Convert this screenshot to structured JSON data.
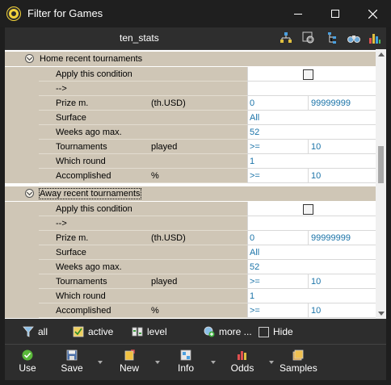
{
  "window": {
    "title": "Filter for Games"
  },
  "header": {
    "title": "ten_stats",
    "icons": [
      "hierarchy-icon",
      "settings-icon",
      "tree-icon",
      "binoculars-icon",
      "bar-chart-icon"
    ]
  },
  "sections": [
    {
      "label": "Home recent tournaments",
      "rows": [
        {
          "name": "Apply this condition",
          "unit": "",
          "value1": "",
          "value2": "",
          "checkbox": true
        },
        {
          "name": "-->",
          "unit": "",
          "value1": "",
          "value2": ""
        },
        {
          "name": "Prize m.",
          "unit": "(th.USD)",
          "value1": "0",
          "value2": "99999999"
        },
        {
          "name": "Surface",
          "unit": "",
          "value1": "All",
          "value2": ""
        },
        {
          "name": "Weeks ago max.",
          "unit": "",
          "value1": "52",
          "value2": ""
        },
        {
          "name": "Tournaments",
          "unit": "played",
          "value1": ">=",
          "value2": "10"
        },
        {
          "name": "Which round",
          "unit": "",
          "value1": "1",
          "value2": ""
        },
        {
          "name": "Accomplished",
          "unit": "%",
          "value1": ">=",
          "value2": "10"
        }
      ]
    },
    {
      "label": "Away recent tournaments",
      "rows": [
        {
          "name": "Apply this condition",
          "unit": "",
          "value1": "",
          "value2": "",
          "checkbox": true
        },
        {
          "name": "-->",
          "unit": "",
          "value1": "",
          "value2": ""
        },
        {
          "name": "Prize m.",
          "unit": "(th.USD)",
          "value1": "0",
          "value2": "99999999"
        },
        {
          "name": "Surface",
          "unit": "",
          "value1": "All",
          "value2": ""
        },
        {
          "name": "Weeks ago max.",
          "unit": "",
          "value1": "52",
          "value2": ""
        },
        {
          "name": "Tournaments",
          "unit": "played",
          "value1": ">=",
          "value2": "10"
        },
        {
          "name": "Which round",
          "unit": "",
          "value1": "1",
          "value2": ""
        },
        {
          "name": "Accomplished",
          "unit": "%",
          "value1": ">=",
          "value2": "10"
        }
      ]
    }
  ],
  "filterbar": {
    "all": "all",
    "active": "active",
    "level": "level",
    "more": "more ...",
    "hide": "Hide"
  },
  "toolbar": {
    "use": "Use",
    "save": "Save",
    "new": "New",
    "info": "Info",
    "odds": "Odds",
    "samples": "Samples"
  }
}
